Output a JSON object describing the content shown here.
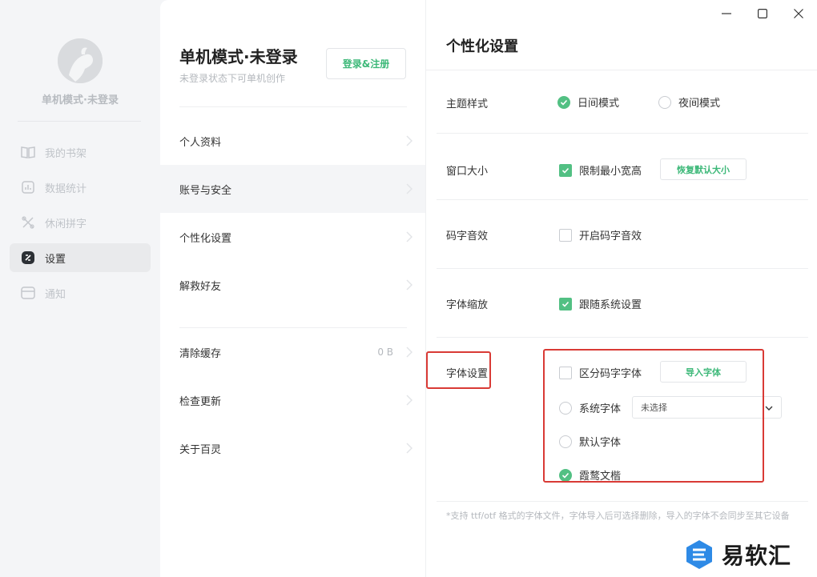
{
  "sidebar": {
    "user_name": "单机模式·未登录",
    "items": [
      {
        "label": "我的书架",
        "icon": "book-icon"
      },
      {
        "label": "数据统计",
        "icon": "stats-icon"
      },
      {
        "label": "休闲拼字",
        "icon": "puzzle-icon"
      },
      {
        "label": "设置",
        "icon": "settings-icon"
      },
      {
        "label": "通知",
        "icon": "mail-icon"
      }
    ],
    "active_index": 3
  },
  "account": {
    "title": "单机模式·未登录",
    "subtitle": "未登录状态下可单机创作",
    "login_label": "登录&注册"
  },
  "menu": {
    "items": [
      {
        "label": "个人资料"
      },
      {
        "label": "账号与安全"
      },
      {
        "label": "个性化设置"
      },
      {
        "label": "解救好友"
      },
      {
        "label": "清除缓存",
        "value": "0 B"
      },
      {
        "label": "检查更新"
      },
      {
        "label": "关于百灵"
      }
    ],
    "active_index": 1
  },
  "personalization": {
    "title": "个性化设置",
    "theme": {
      "label": "主题样式",
      "day": "日间模式",
      "night": "夜间模式",
      "selected": "day"
    },
    "window": {
      "label": "窗口大小",
      "limit_min": "限制最小宽高",
      "limit_checked": true,
      "reset_label": "恢复默认大小"
    },
    "typing_sound": {
      "label": "码字音效",
      "enable": "开启码字音效",
      "checked": false
    },
    "font_scale": {
      "label": "字体缩放",
      "follow_system": "跟随系统设置",
      "checked": true
    },
    "font": {
      "label": "字体设置",
      "distinguish": "区分码字字体",
      "distinguish_checked": false,
      "import_label": "导入字体",
      "system_font": "系统字体",
      "system_select_value": "未选择",
      "default_font": "默认字体",
      "lxgw": "霞鹜文楷",
      "selected": "lxgw"
    },
    "footnote": "*支持 ttf/otf 格式的字体文件，字体导入后可选择删除，导入的字体不会同步至其它设备"
  },
  "watermark": {
    "text": "易软汇"
  },
  "colors": {
    "accent": "#52c083",
    "highlight": "#d93a35"
  }
}
